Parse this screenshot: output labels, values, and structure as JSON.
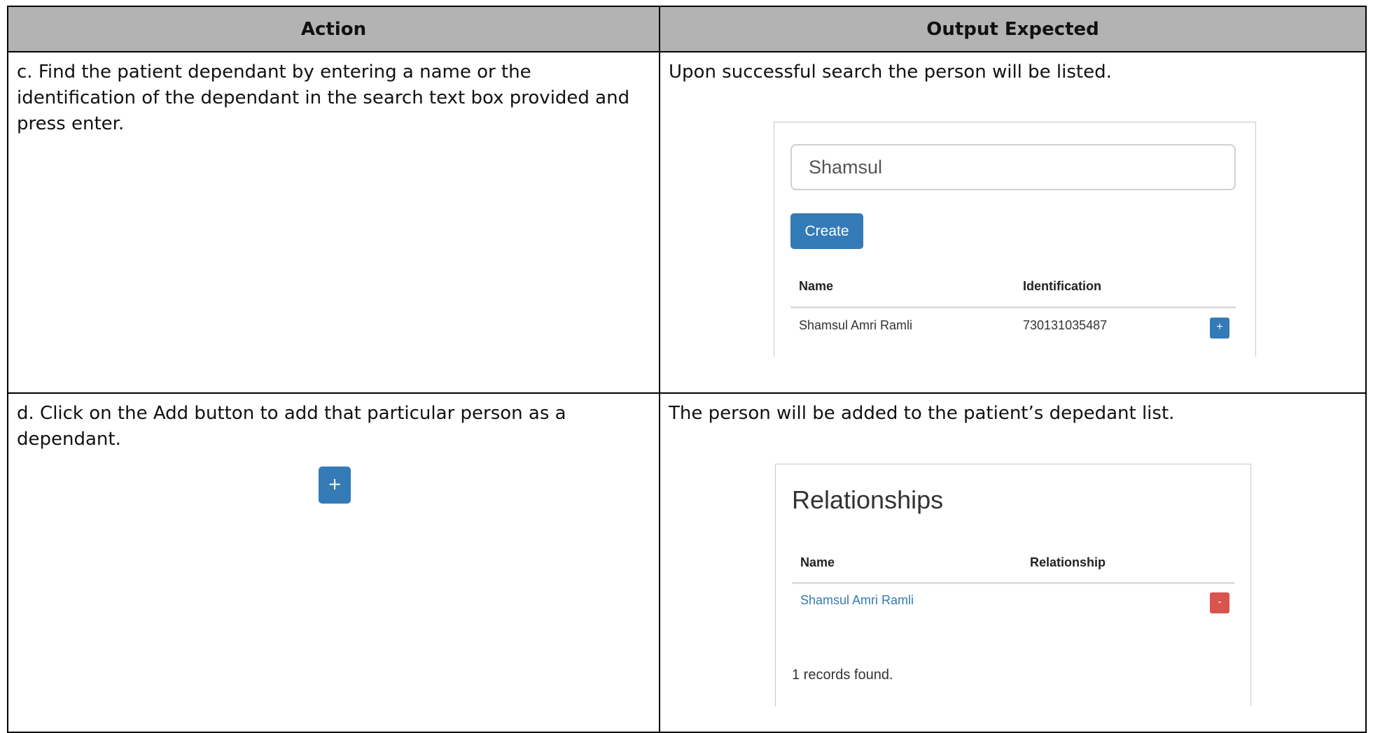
{
  "table": {
    "headers": [
      "Action",
      "Output Expected"
    ]
  },
  "rows": [
    {
      "action": "c. Find the patient dependant by entering a name or the identification of the dependant in the search text box provided and press enter.",
      "expected": "Upon successful search the person will be listed.",
      "screenshot": {
        "search_value": "Shamsul",
        "create_label": "Create",
        "columns": [
          "Name",
          "Identification"
        ],
        "result_name": "Shamsul Amri Ramli",
        "result_id": "730131035487",
        "add_label": "+"
      }
    },
    {
      "action": "d. Click on the Add button to add that particular person as a dependant.",
      "add_button_label": "+",
      "expected": "The person will be added to the patient’s depedant list.",
      "screenshot": {
        "title": "Relationships",
        "columns": [
          "Name",
          "Relationship"
        ],
        "result_name": "Shamsul Amri Ramli",
        "remove_label": "-",
        "records_text": "1 records found."
      }
    }
  ],
  "colors": {
    "header_bg": "#b3b3b3",
    "primary_button": "#337ab7",
    "danger_button": "#d9534f",
    "link": "#337ab7"
  }
}
